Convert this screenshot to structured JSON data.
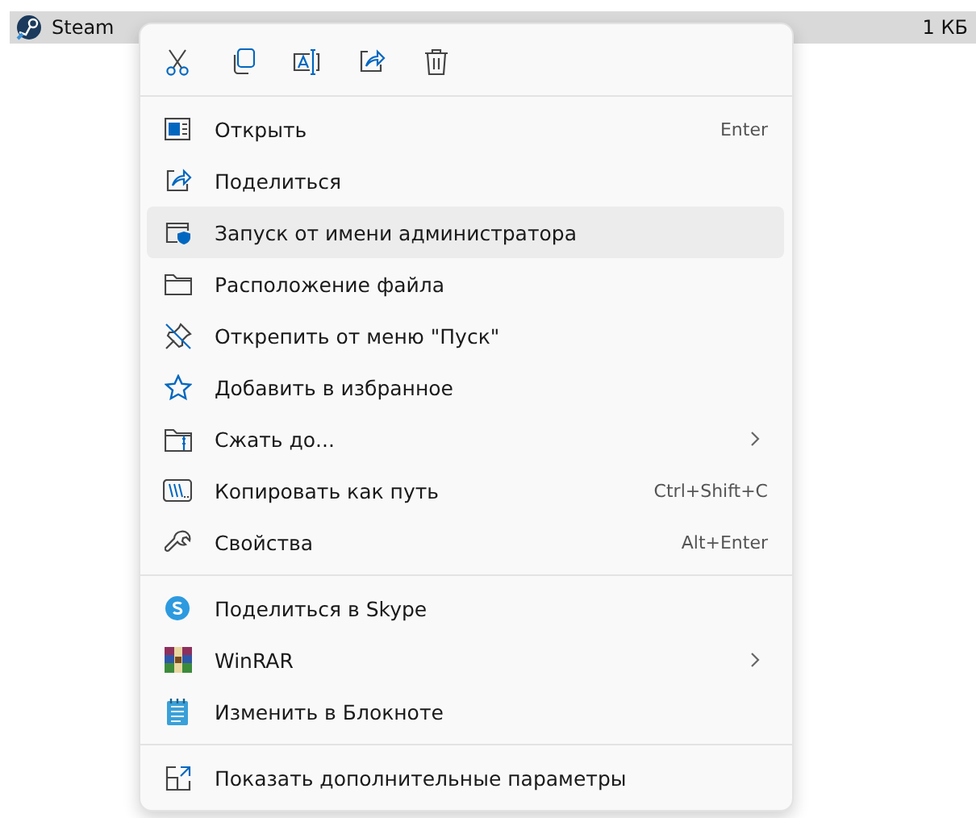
{
  "file_row": {
    "name": "Steam",
    "size": "1 КБ",
    "selected": true
  },
  "menu": {
    "sections": [
      {
        "items": [
          {
            "label": "Открыть",
            "shortcut": "Enter",
            "submenu": false,
            "selected": false
          },
          {
            "label": "Поделиться",
            "submenu": false,
            "selected": false
          },
          {
            "label": "Запуск от имени администратора",
            "submenu": false,
            "selected": true
          },
          {
            "label": "Расположение файла",
            "submenu": false,
            "selected": false
          },
          {
            "label": "Открепить от меню \"Пуск\"",
            "submenu": false,
            "selected": false
          },
          {
            "label": "Добавить в избранное",
            "submenu": false,
            "selected": false
          },
          {
            "label": "Сжать до...",
            "submenu": true,
            "selected": false
          },
          {
            "label": "Копировать как путь",
            "shortcut": "Ctrl+Shift+C",
            "submenu": false,
            "selected": false
          },
          {
            "label": "Свойства",
            "shortcut": "Alt+Enter",
            "submenu": false,
            "selected": false
          }
        ]
      },
      {
        "items": [
          {
            "label": "Поделиться в Skype",
            "submenu": false,
            "selected": false
          },
          {
            "label": "WinRAR",
            "submenu": true,
            "selected": false
          },
          {
            "label": "Изменить в Блокноте",
            "submenu": false,
            "selected": false
          }
        ]
      },
      {
        "items": [
          {
            "label": "Показать дополнительные параметры",
            "submenu": false,
            "selected": false
          }
        ]
      }
    ]
  }
}
